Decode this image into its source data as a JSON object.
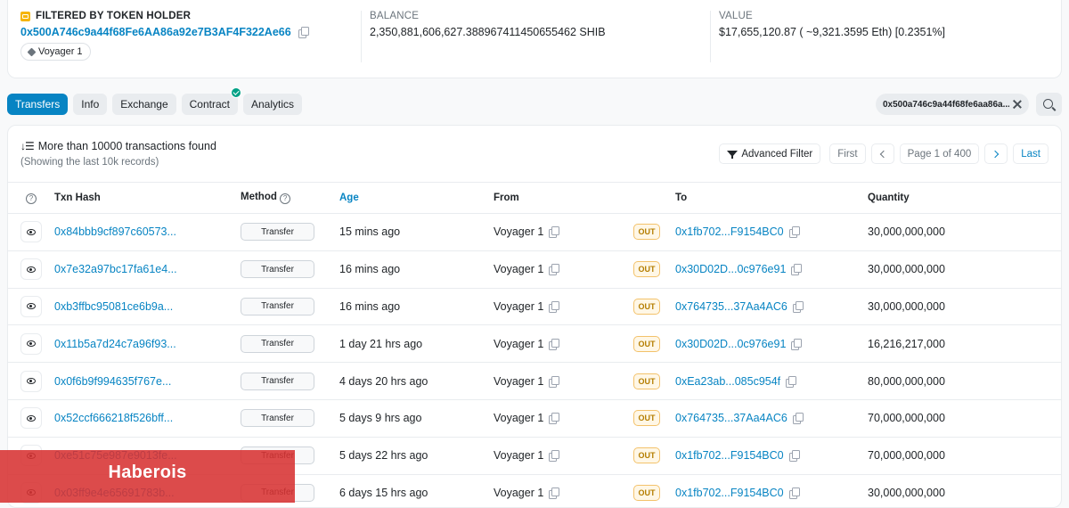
{
  "summary": {
    "filter_label": "FILTERED BY TOKEN HOLDER",
    "holder_address": "0x500A746c9a44f68Fe6AA86a92e7B3AF4F322Ae66",
    "holder_tag": "Voyager 1",
    "balance_label": "BALANCE",
    "balance_value": "2,350,881,606,627.388967411450655462 SHIB",
    "value_label": "VALUE",
    "value_value": "$17,655,120.87 ( ~9,321.3595 Eth) [0.2351%]"
  },
  "tabs": [
    {
      "label": "Transfers",
      "active": true
    },
    {
      "label": "Info"
    },
    {
      "label": "Exchange"
    },
    {
      "label": "Contract",
      "verified": true
    },
    {
      "label": "Analytics"
    }
  ],
  "filter_pill": {
    "text": "0x500a746c9a44f68fe6aa86a..."
  },
  "results": {
    "title": "More than 10000 transactions found",
    "subtitle": "(Showing the last 10k records)"
  },
  "pager": {
    "advanced_filter": "Advanced Filter",
    "first": "First",
    "page": "Page 1 of 400",
    "last": "Last"
  },
  "table": {
    "headers": {
      "txn_hash": "Txn Hash",
      "method": "Method",
      "age": "Age",
      "from": "From",
      "to": "To",
      "quantity": "Quantity"
    },
    "rows": [
      {
        "hash": "0x84bbb9cf897c60573...",
        "method": "Transfer",
        "age": "15 mins ago",
        "from": "Voyager 1",
        "dir": "OUT",
        "to": "0x1fb702...F9154BC0",
        "qty": "30,000,000,000"
      },
      {
        "hash": "0x7e32a97bc17fa61e4...",
        "method": "Transfer",
        "age": "16 mins ago",
        "from": "Voyager 1",
        "dir": "OUT",
        "to": "0x30D02D...0c976e91",
        "qty": "30,000,000,000"
      },
      {
        "hash": "0xb3ffbc95081ce6b9a...",
        "method": "Transfer",
        "age": "16 mins ago",
        "from": "Voyager 1",
        "dir": "OUT",
        "to": "0x764735...37Aa4AC6",
        "qty": "30,000,000,000"
      },
      {
        "hash": "0x11b5a7d24c7a96f93...",
        "method": "Transfer",
        "age": "1 day 21 hrs ago",
        "from": "Voyager 1",
        "dir": "OUT",
        "to": "0x30D02D...0c976e91",
        "qty": "16,216,217,000"
      },
      {
        "hash": "0x0f6b9f994635f767e...",
        "method": "Transfer",
        "age": "4 days 20 hrs ago",
        "from": "Voyager 1",
        "dir": "OUT",
        "to": "0xEa23ab...085c954f",
        "qty": "80,000,000,000"
      },
      {
        "hash": "0x52ccf666218f526bff...",
        "method": "Transfer",
        "age": "5 days 9 hrs ago",
        "from": "Voyager 1",
        "dir": "OUT",
        "to": "0x764735...37Aa4AC6",
        "qty": "70,000,000,000"
      },
      {
        "hash": "0xe51c75e987e9013fe...",
        "method": "Transfer",
        "age": "5 days 22 hrs ago",
        "from": "Voyager 1",
        "dir": "OUT",
        "to": "0x1fb702...F9154BC0",
        "qty": "70,000,000,000"
      },
      {
        "hash": "0x03ff9e4e65691783b...",
        "method": "Transfer",
        "age": "6 days 15 hrs ago",
        "from": "Voyager 1",
        "dir": "OUT",
        "to": "0x1fb702...F9154BC0",
        "qty": "30,000,000,000"
      }
    ]
  },
  "watermark": "Haberois"
}
